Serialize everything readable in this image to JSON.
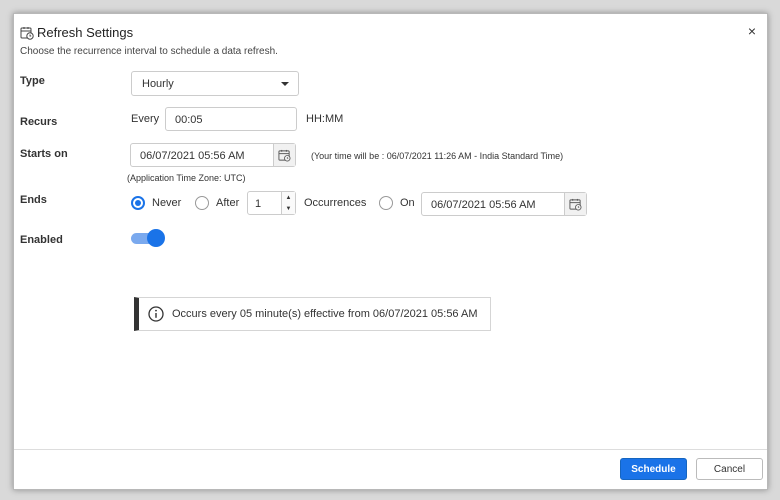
{
  "dialog": {
    "title": "Refresh Settings",
    "subtitle": "Choose the recurrence interval to schedule a data refresh.",
    "close_glyph": "×"
  },
  "type": {
    "label": "Type",
    "value": "Hourly"
  },
  "recurs": {
    "label": "Recurs",
    "every_label": "Every",
    "value": "00:05",
    "format_label": "HH:MM"
  },
  "starts_on": {
    "label": "Starts on",
    "value": "06/07/2021 05:56 AM",
    "local_time_note": "(Your time will be : 06/07/2021 11:26 AM - India Standard Time)",
    "timezone_note": "(Application Time Zone: UTC)"
  },
  "ends": {
    "label": "Ends",
    "options": {
      "never": "Never",
      "after": "After",
      "on": "On"
    },
    "selected": "never",
    "occurrences_value": "1",
    "occurrences_label": "Occurrences",
    "on_date": "06/07/2021 05:56 AM"
  },
  "enabled": {
    "label": "Enabled",
    "value": true
  },
  "info": {
    "message": "Occurs every 05 minute(s) effective from 06/07/2021 05:56 AM"
  },
  "footer": {
    "schedule_label": "Schedule",
    "cancel_label": "Cancel"
  },
  "colors": {
    "accent": "#1a73e8"
  },
  "icons": {
    "title": "calendar-clock-icon",
    "calendar": "calendar-icon",
    "info": "info-icon",
    "close": "close-icon",
    "dropdown": "chevron-down-icon"
  }
}
